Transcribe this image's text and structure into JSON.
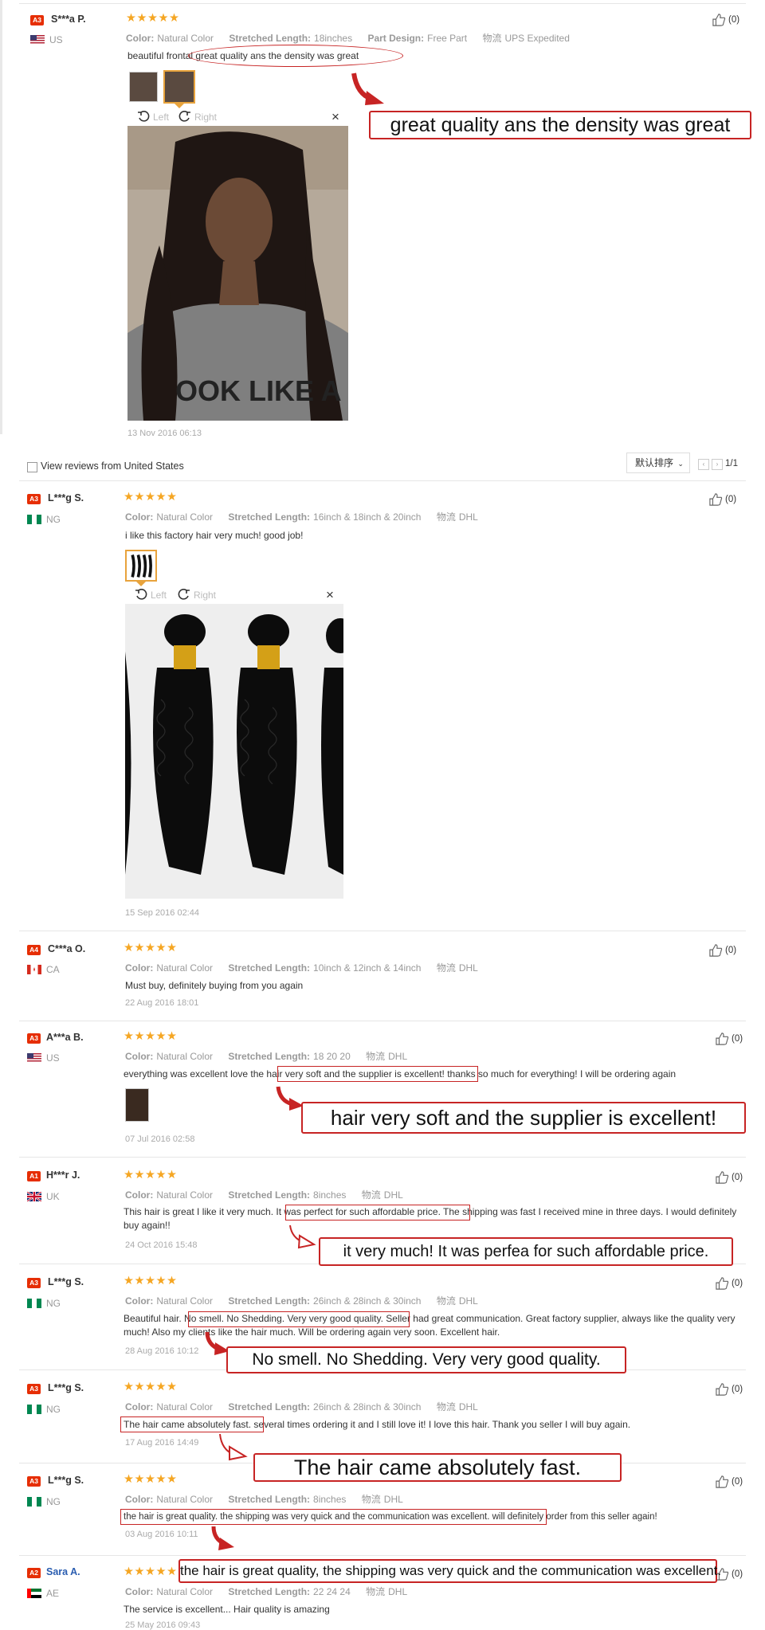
{
  "reviews": [
    {
      "level": "A3",
      "name": "S***a P.",
      "country": "US",
      "attrs": [
        {
          "k": "Color:",
          "v": "Natural Color"
        },
        {
          "k": "Stretched Length:",
          "v": "18inches"
        },
        {
          "k": "Part Design:",
          "v": "Free Part"
        },
        {
          "k": "物流",
          "v": "UPS Expedited"
        }
      ],
      "text": "beautiful frontal great quality ans the density was great",
      "date": "13 Nov 2016 06:13",
      "helpful": "(0)"
    },
    {
      "level": "A3",
      "name": "L***g S.",
      "country": "NG",
      "attrs": [
        {
          "k": "Color:",
          "v": "Natural Color"
        },
        {
          "k": "Stretched Length:",
          "v": "16inch & 18inch & 20inch"
        },
        {
          "k": "物流",
          "v": "DHL"
        }
      ],
      "text": "i like this factory hair very much! good job!",
      "date": "15 Sep 2016 02:44",
      "helpful": "(0)"
    },
    {
      "level": "A4",
      "name": "C***a O.",
      "country": "CA",
      "attrs": [
        {
          "k": "Color:",
          "v": "Natural Color"
        },
        {
          "k": "Stretched Length:",
          "v": "10inch & 12inch & 14inch"
        },
        {
          "k": "物流",
          "v": "DHL"
        }
      ],
      "text": "Must buy, definitely buying from you again",
      "date": "22 Aug 2016 18:01",
      "helpful": "(0)"
    },
    {
      "level": "A3",
      "name": "A***a B.",
      "country": "US",
      "attrs": [
        {
          "k": "Color:",
          "v": "Natural Color"
        },
        {
          "k": "Stretched Length:",
          "v": "18 20 20"
        },
        {
          "k": "物流",
          "v": "DHL"
        }
      ],
      "text": "everything was excellent love the hair very soft and the supplier is excellent! thanks so much for everything! I will be ordering again",
      "date": "07 Jul 2016 02:58",
      "helpful": "(0)"
    },
    {
      "level": "A1",
      "name": "H***r J.",
      "country": "UK",
      "attrs": [
        {
          "k": "Color:",
          "v": "Natural Color"
        },
        {
          "k": "Stretched Length:",
          "v": "8inches"
        },
        {
          "k": "物流",
          "v": "DHL"
        }
      ],
      "text": "This hair is great I like it very much. It was perfect for such affordable price. The shipping was fast I received mine in three days. I would definitely buy again!!",
      "date": "24 Oct 2016 15:48",
      "helpful": "(0)"
    },
    {
      "level": "A3",
      "name": "L***g S.",
      "country": "NG",
      "attrs": [
        {
          "k": "Color:",
          "v": "Natural Color"
        },
        {
          "k": "Stretched Length:",
          "v": "26inch & 28inch & 30inch"
        },
        {
          "k": "物流",
          "v": "DHL"
        }
      ],
      "text": "Beautiful hair. No smell. No Shedding. Very very good quality. Seller had great communication. Great factory supplier, always like the quality very much! Also my clients like the hair much. Will be ordering again very soon. Excellent hair.",
      "date": "28 Aug 2016 10:12",
      "helpful": "(0)"
    },
    {
      "level": "A3",
      "name": "L***g S.",
      "country": "NG",
      "attrs": [
        {
          "k": "Color:",
          "v": "Natural Color"
        },
        {
          "k": "Stretched Length:",
          "v": "26inch & 28inch & 30inch"
        },
        {
          "k": "物流",
          "v": "DHL"
        }
      ],
      "text": "The hair came absolutely fast. several times ordering it and I still love it! I love this hair.  Thank you seller I will buy again.",
      "date": "17 Aug 2016 14:49",
      "helpful": "(0)"
    },
    {
      "level": "A3",
      "name": "L***g S.",
      "country": "NG",
      "attrs": [
        {
          "k": "Color:",
          "v": "Natural Color"
        },
        {
          "k": "Stretched Length:",
          "v": "8inches"
        },
        {
          "k": "物流",
          "v": "DHL"
        }
      ],
      "text": "the hair is great quality. the shipping was very quick and the communication was excellent.  will definitely order from this seller again!",
      "date": "03 Aug 2016 10:11",
      "helpful": "(0)"
    },
    {
      "level": "A2",
      "name": "Sara A.",
      "country": "AE",
      "attrs": [
        {
          "k": "Color:",
          "v": "Natural Color"
        },
        {
          "k": "Stretched Length:",
          "v": "22 24 24"
        },
        {
          "k": "物流",
          "v": "DHL"
        }
      ],
      "text": "The service is excellent... Hair quality is amazing",
      "date": "25 May 2016 09:43",
      "helpful": "(0)"
    }
  ],
  "stars": "★★★★★",
  "viewer": {
    "left": "Left",
    "right": "Right",
    "close": "×"
  },
  "filter": {
    "label": "View reviews from United States",
    "sort": "默认排序",
    "page": "1/1"
  },
  "callouts": [
    "great quality ans the density was great",
    "hair very soft and the supplier is excellent!",
    "it very much! It was perfea for such affordable price.",
    "No smell. No Shedding. Very very good quality.",
    "The hair came absolutely fast.",
    "the hair is great quality, the shipping was very quick and the communication was excellent."
  ],
  "photo_text": "OOK LIKE A",
  "colors": {
    "accent": "#c72424",
    "stars": "#f5a623",
    "level": "#e62e04"
  }
}
